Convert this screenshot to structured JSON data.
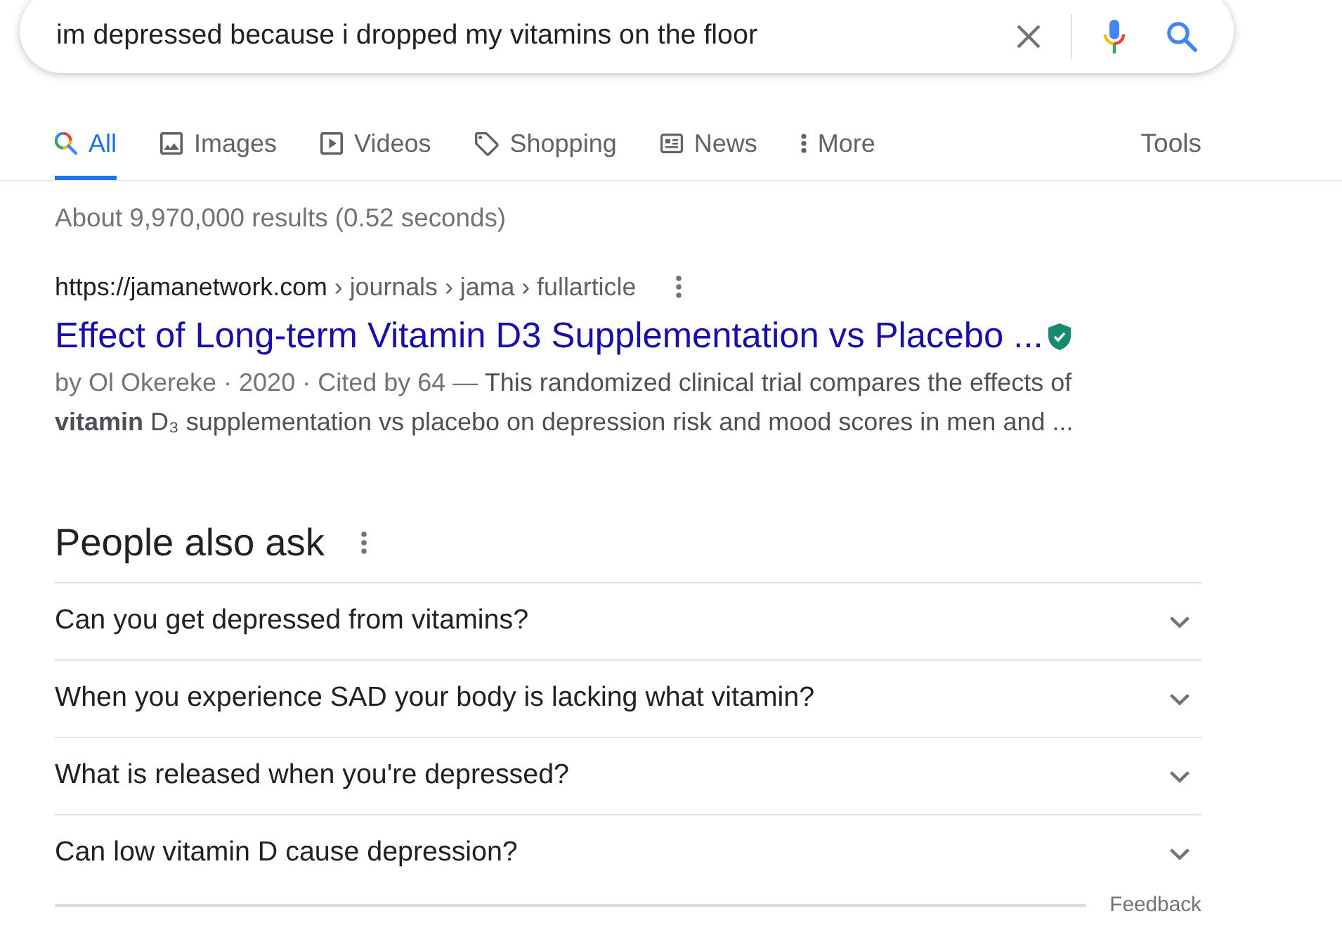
{
  "search": {
    "value": "im depressed because i dropped my vitamins on the floor"
  },
  "tabs": [
    {
      "label": "All",
      "kind": "all",
      "selected": true
    },
    {
      "label": "Images",
      "kind": "images",
      "selected": false
    },
    {
      "label": "Videos",
      "kind": "videos",
      "selected": false
    },
    {
      "label": "Shopping",
      "kind": "shopping",
      "selected": false
    },
    {
      "label": "News",
      "kind": "news",
      "selected": false
    },
    {
      "label": "More",
      "kind": "more",
      "selected": false
    }
  ],
  "tools": "Tools",
  "result_stats": "About 9,970,000 results (0.52 seconds)",
  "results": [
    {
      "domain": "https://jamanetwork.com",
      "path": "› journals › jama › fullarticle",
      "title": "Effect of Long-term Vitamin D3 Supplementation vs Placebo ...",
      "verified": true,
      "byline": "by Ol Okereke · 2020 · Cited by 64 —",
      "snippet": "This randomized clinical trial compares the effects of **vitamin** D₃ supplementation vs placebo on depression risk and mood scores in men and ..."
    }
  ],
  "people_also_ask": {
    "title": "People also ask",
    "questions": [
      {
        "text": "Can you get depressed from vitamins?",
        "expanded": false
      },
      {
        "text": "When you experience SAD your body is lacking what vitamin?",
        "expanded": false
      },
      {
        "text": "What is released when you're depressed?",
        "expanded": false
      },
      {
        "text": "Can low vitamin D cause depression?",
        "expanded": false
      }
    ]
  },
  "feedback": "Feedback"
}
